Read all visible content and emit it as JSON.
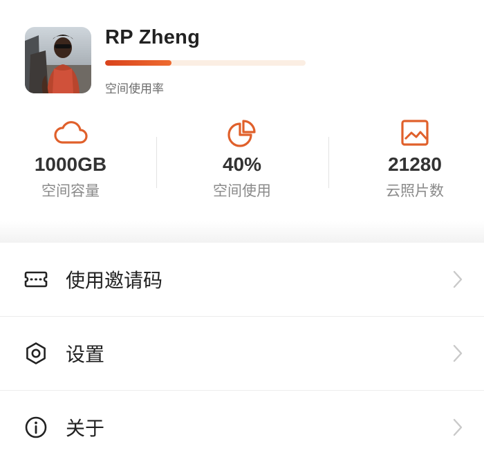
{
  "profile": {
    "name": "RP Zheng",
    "usage_label": "空间使用率",
    "usage_fraction": 0.33
  },
  "stats": [
    {
      "icon": "cloud-icon",
      "value": "1000GB",
      "label": "空间容量"
    },
    {
      "icon": "pie-chart-icon",
      "value": "40%",
      "label": "空间使用"
    },
    {
      "icon": "image-icon",
      "value": "21280",
      "label": "云照片数"
    }
  ],
  "menu": [
    {
      "icon": "ticket-icon",
      "label": "使用邀请码"
    },
    {
      "icon": "gear-icon",
      "label": "设置"
    },
    {
      "icon": "info-icon",
      "label": "关于"
    }
  ],
  "colors": {
    "accent": "#e0602b",
    "progress_start": "#d9431c",
    "progress_track": "#fbeee3",
    "muted_text": "#8a8a8a"
  }
}
